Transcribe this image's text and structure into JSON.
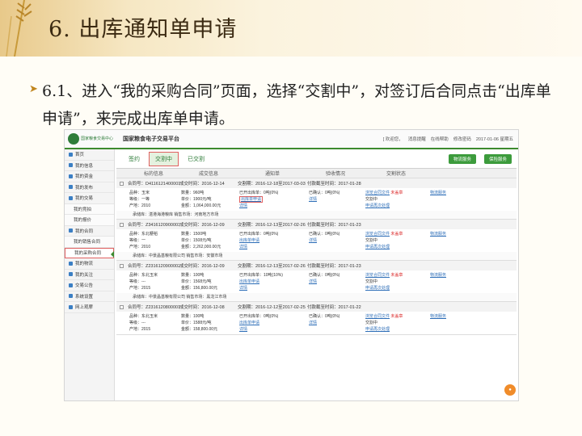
{
  "slide": {
    "title": "6. 出库通知单申请",
    "bullet": "6.1、进入“我的采购合同”页面，选择“交割中”，对签订后合同点击“出库单申请”，来完成出库单申请。"
  },
  "app": {
    "logo": "国家粮食交易中心",
    "platform": "国家粮食电子交易平台",
    "user": "[ 欢迎您，",
    "msg": "消息提醒",
    "help": "在线帮助",
    "pwd": "修改密码",
    "date": "2017-01-06 星期五"
  },
  "sidebar": [
    {
      "label": "首页",
      "sub": false
    },
    {
      "label": "我的信息",
      "sub": false
    },
    {
      "label": "我的资金",
      "sub": false
    },
    {
      "label": "我的发布",
      "sub": false
    },
    {
      "label": "我的交易",
      "sub": false
    },
    {
      "label": "我的竞拍",
      "sub": true
    },
    {
      "label": "我的报价",
      "sub": true
    },
    {
      "label": "我的合同",
      "sub": false
    },
    {
      "label": "我的销售合同",
      "sub": true
    },
    {
      "label": "我的采购合同",
      "sub": true,
      "active": true
    },
    {
      "label": "我的物流",
      "sub": false
    },
    {
      "label": "我的关注",
      "sub": false
    },
    {
      "label": "交易公告",
      "sub": false
    },
    {
      "label": "系统设置",
      "sub": false
    },
    {
      "label": "网上观摩",
      "sub": false
    }
  ],
  "tabs": [
    "签约",
    "交割中",
    "已交割"
  ],
  "tab_buttons": [
    "物流服务",
    "保险服务"
  ],
  "columns": [
    "",
    "标的信息",
    "成交信息",
    "通知单",
    "验收情况",
    "交割状态",
    ""
  ],
  "orders": [
    {
      "contract": "合同号：D4116121400001",
      "deal_date": "成交时间：2016-12-14",
      "delivery": "交割期：2016-12-18至2017-03-03",
      "pay": "付款截至时间：2017-01-28",
      "goods": "品种：玉米",
      "grade": "等级：一等",
      "origin": "产地：2010",
      "qty": "数量：960吨",
      "price": "单价：1900元/吨",
      "amount": "金额：1,064,000.00元",
      "out_notice": "已开出库单：0吨(0%)",
      "out_link": "出库单申请",
      "detail1": "详情",
      "check": "已确认：0吨(0%)",
      "detail2": "详情",
      "status_link": "浏览合同文件",
      "status_red": "未盖章",
      "status2": "交割中",
      "status3": "申请再次处理",
      "svc": "物流服务",
      "foot": "承储库：湛港海港粮库   销售市场：河南地方市场"
    },
    {
      "contract": "合同号：Z3416120900003",
      "deal_date": "成交时间：2016-12-09",
      "delivery": "交割期：2016-12-13至2017-02-26",
      "pay": "付款截至时间：2017-01-23",
      "goods": "品种：东北粳稻",
      "grade": "等级：一",
      "origin": "产地：2010",
      "qty": "数量：1500吨",
      "price": "单价：1508元/吨",
      "amount": "金额：2,262,000.00元",
      "out_notice": "已开出库单：0吨(0%)",
      "out_link": "出库单申请",
      "detail1": "详情",
      "check": "已确认：0吨(0%)",
      "detail2": "详情",
      "status_link": "浏览合同文件",
      "status_red": "未盖章",
      "status2": "交割中",
      "status3": "申请再次处理",
      "svc": "物流服务",
      "foot": "承储库：中景晶基粮有限公司   销售市场：安徽市场"
    },
    {
      "contract": "合同号：Z2316120900002",
      "deal_date": "成交时间：2016-12-09",
      "delivery": "交割期：2016-12-13至2017-02-26",
      "pay": "付款截至时间：2017-01-23",
      "goods": "品种：东北玉米",
      "grade": "等级：---",
      "origin": "产地：2015",
      "qty": "数量：100吨",
      "price": "单价：1568元/吨",
      "amount": "金额：156,800.00元",
      "out_notice": "已开出库单：10吨(10%)",
      "out_link": "出库单申请",
      "detail1": "详情",
      "check": "已确认：0吨(0%)",
      "detail2": "详情",
      "status_link": "浏览合同文件",
      "status_red": "未盖章",
      "status2": "交割中",
      "status3": "申请再次处理",
      "svc": "物流服务",
      "foot": "承储库：中景晶基粮有限公司   销售市场：黑龙江市场"
    },
    {
      "contract": "合同号：Z2316120800001",
      "deal_date": "成交时间：2016-12-08",
      "delivery": "交割期：2016-12-12至2017-02-25",
      "pay": "付款截至时间：2017-01-22",
      "goods": "品种：东北玉米",
      "grade": "等级：---",
      "origin": "产地：2015",
      "qty": "数量：100吨",
      "price": "单价：1588元/吨",
      "amount": "金额：158,800.00元",
      "out_notice": "已开出库单：0吨(0%)",
      "out_link": "出库单申请",
      "detail1": "详情",
      "check": "已确认：0吨(0%)",
      "detail2": "详情",
      "status_link": "浏览合同文件",
      "status_red": "未盖章",
      "status2": "交割中",
      "status3": "申请再次处理",
      "svc": "物流服务",
      "foot": ""
    }
  ]
}
